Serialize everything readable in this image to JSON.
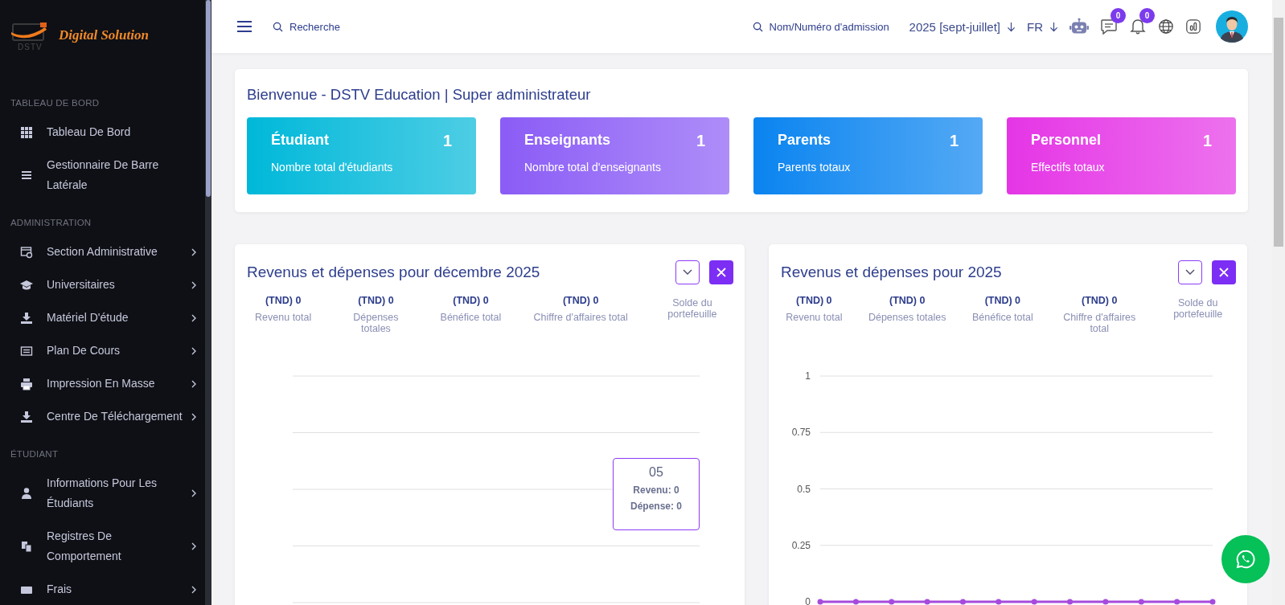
{
  "sidebar": {
    "logo": {
      "name": "Digital Solution",
      "sub": "DSTV"
    },
    "sections": [
      {
        "heading": "TABLEAU DE BORD",
        "items": [
          {
            "label": "Tableau De Bord",
            "has_submenu": false
          },
          {
            "label": "Gestionnaire De Barre Latérale",
            "has_submenu": false
          }
        ]
      },
      {
        "heading": "ADMINISTRATION",
        "items": [
          {
            "label": "Section Administrative",
            "has_submenu": true
          },
          {
            "label": "Universitaires",
            "has_submenu": true
          },
          {
            "label": "Matériel D'étude",
            "has_submenu": true
          },
          {
            "label": "Plan De Cours",
            "has_submenu": true
          },
          {
            "label": "Impression En Masse",
            "has_submenu": true
          },
          {
            "label": "Centre De Téléchargement",
            "has_submenu": true
          }
        ]
      },
      {
        "heading": "ÉTUDIANT",
        "items": [
          {
            "label": "Informations Pour Les Étudiants",
            "has_submenu": true
          },
          {
            "label": "Registres De Comportement",
            "has_submenu": true
          },
          {
            "label": "Frais",
            "has_submenu": true
          }
        ]
      }
    ]
  },
  "header": {
    "search": {
      "placeholder": "Recherche"
    },
    "admission_search": {
      "placeholder": "Nom/Numéro d'admission"
    },
    "session": "2025 [sept-juillet]",
    "language": "FR",
    "messages_badge": "0",
    "notifications_badge": "0"
  },
  "welcome": {
    "title": "Bienvenue - DSTV Education | Super administrateur",
    "stats": [
      {
        "title": "Étudiant",
        "count": "1",
        "subtitle": "Nombre total d'étudiants",
        "color": "#00b8d9"
      },
      {
        "title": "Enseignants",
        "count": "1",
        "subtitle": "Nombre total d'enseignants",
        "color": "#8b5cf6"
      },
      {
        "title": "Parents",
        "count": "1",
        "subtitle": "Parents totaux",
        "color": "#0a84f0"
      },
      {
        "title": "Personnel",
        "count": "1",
        "subtitle": "Effectifs totaux",
        "color": "#e535e6"
      }
    ]
  },
  "charts": [
    {
      "title": "Revenus et dépenses pour décembre 2025",
      "summary": [
        {
          "value": "(TND) 0",
          "label": "Revenu total"
        },
        {
          "value": "(TND) 0",
          "label": "Dépenses totales"
        },
        {
          "value": "(TND) 0",
          "label": "Bénéfice total"
        },
        {
          "value": "(TND) 0",
          "label": "Chiffre d'affaires total"
        },
        {
          "label": "Solde du portefeuille"
        }
      ],
      "tooltip": {
        "title": "05",
        "lines": [
          "Revenu: 0",
          "Dépense: 0"
        ]
      }
    },
    {
      "title": "Revenus et dépenses pour 2025",
      "summary": [
        {
          "value": "(TND) 0",
          "label": "Revenu total"
        },
        {
          "value": "(TND) 0",
          "label": "Dépenses totales"
        },
        {
          "value": "(TND) 0",
          "label": "Bénéfice total"
        },
        {
          "value": "(TND) 0",
          "label": "Chiffre d'affaires total"
        },
        {
          "label": "Solde du portefeuille"
        }
      ],
      "chart_data": {
        "type": "line",
        "grid": true,
        "ylim": [
          0,
          1
        ],
        "yticks": [
          0,
          0.25,
          0.5,
          0.75,
          1
        ],
        "series": [
          {
            "color": "#a64bdc",
            "marker": true,
            "values": [
              0,
              0,
              0,
              0,
              0,
              0,
              0,
              0,
              0,
              0,
              0,
              0
            ]
          }
        ]
      }
    }
  ]
}
